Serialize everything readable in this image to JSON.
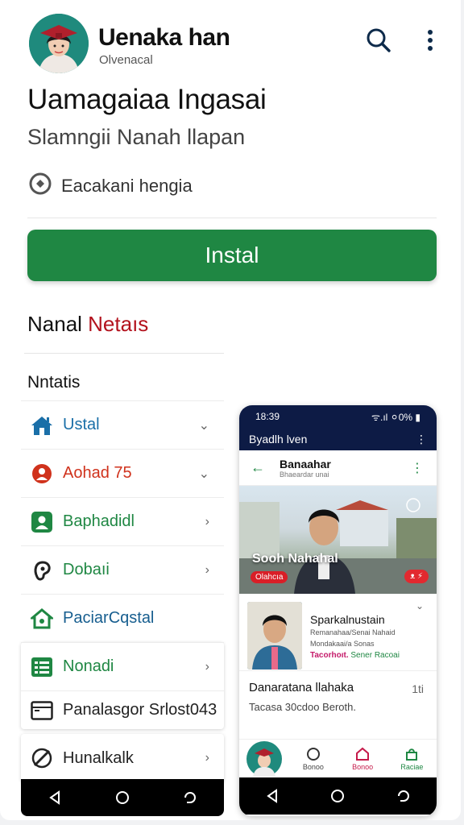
{
  "header": {
    "app_name": "Uenaka han",
    "app_sub": "Olvenacal",
    "search_icon": "search-icon",
    "more_icon": "more-vert-icon"
  },
  "headline": "Uamagaiaa Ingasai",
  "subline": "Slamngii Nanah llapan",
  "meta": {
    "icon": "rating-icon",
    "text": "Eacakani hengia"
  },
  "install_label": "Instal",
  "section": {
    "title_main": "Nanal ",
    "title_accent": "Netaıs"
  },
  "list_head": "Nntatis",
  "list": [
    {
      "label": "Ustal",
      "icon": "home-icon",
      "color": "#1a6fa8",
      "chevron": "⌄"
    },
    {
      "label": "Aohad 75",
      "icon": "location-icon",
      "color": "#d0321c",
      "chevron": "⌄"
    },
    {
      "label": "Baphadidl",
      "icon": "contact-icon",
      "color": "#1f8743",
      "chevron": "›"
    },
    {
      "label": "Dobaıi",
      "icon": "ear-icon",
      "color": "#1f8743",
      "chevron": "›"
    },
    {
      "label": "PaciarCqstal",
      "icon": "house-gear-icon",
      "color": "#175e8f",
      "chevron": ""
    },
    {
      "label": "Nonadi",
      "icon": "list-icon",
      "color": "#1f8743",
      "chevron": "›"
    },
    {
      "label": "Panalasgor Srlost043",
      "icon": "window-icon",
      "color": "#222",
      "chevron": ""
    },
    {
      "label": "Hunalkalk",
      "icon": "compass-icon",
      "color": "#222",
      "chevron": "›"
    }
  ],
  "phone": {
    "status_time": "18:39",
    "status_right": "ᯤ.ıl ⚪0% ▮",
    "bar_title": "Byadlh lven",
    "top_title": "Banaahar",
    "top_sub": "Bhaeardar unai",
    "hero_caption": "Sooh Nahahal",
    "hero_tag_left": "Olahcıa",
    "hero_tag_right": "ᴥ ⚡",
    "item_title": "Sparkalnustain",
    "item_sub1": "Remanahaa/Senai Nahaid",
    "item_sub2": "Mondakaai/a Sonas",
    "item_tag1": "Tacorhoıt.",
    "item_tag2": "Sener Racoai",
    "row2_title": "Danaratana llahaka",
    "row2_sub": "Tacasa 30cdoo Beroth.",
    "row2_num": "1ti",
    "nav": [
      {
        "label": "Bonoo",
        "icon": "profile-icon"
      },
      {
        "label": "Bonoo",
        "icon": "home-outline-icon"
      },
      {
        "label": "Raciae",
        "icon": "bag-icon"
      }
    ]
  },
  "colors": {
    "install": "#1f8743",
    "accent_red": "#b3121d",
    "phone_bar": "#0d1b45"
  }
}
